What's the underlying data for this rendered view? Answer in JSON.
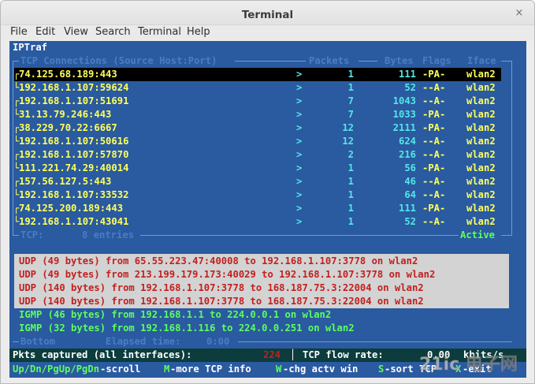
{
  "window": {
    "title": "Terminal",
    "close_glyph": "×"
  },
  "menu": [
    "File",
    "Edit",
    "View",
    "Search",
    "Terminal",
    "Help"
  ],
  "app_title": "IPTraf",
  "header": {
    "connections": "TCP Connections (Source Host:Port)",
    "packets": "Packets",
    "bytes": "Bytes",
    "flags": "Flags",
    "iface": "Iface"
  },
  "tcp_rows": [
    {
      "host": "74.125.68.189:443",
      "dir": ">",
      "packets": "1",
      "bytes": "111",
      "flags": "-PA-",
      "iface": "wlan2",
      "selected": true
    },
    {
      "host": "192.168.1.107:59624",
      "dir": ">",
      "packets": "1",
      "bytes": "52",
      "flags": "--A-",
      "iface": "wlan2"
    },
    {
      "host": "192.168.1.107:51691",
      "dir": ">",
      "packets": "7",
      "bytes": "1043",
      "flags": "--A-",
      "iface": "wlan2"
    },
    {
      "host": "31.13.79.246:443",
      "dir": ">",
      "packets": "7",
      "bytes": "1033",
      "flags": "-PA-",
      "iface": "wlan2"
    },
    {
      "host": "38.229.70.22:6667",
      "dir": ">",
      "packets": "12",
      "bytes": "2111",
      "flags": "-PA-",
      "iface": "wlan2"
    },
    {
      "host": "192.168.1.107:50616",
      "dir": ">",
      "packets": "12",
      "bytes": "624",
      "flags": "--A-",
      "iface": "wlan2"
    },
    {
      "host": "192.168.1.107:57870",
      "dir": ">",
      "packets": "2",
      "bytes": "216",
      "flags": "--A-",
      "iface": "wlan2"
    },
    {
      "host": "111.221.74.29:40014",
      "dir": ">",
      "packets": "1",
      "bytes": "56",
      "flags": "-PA-",
      "iface": "wlan2"
    },
    {
      "host": "157.56.127.5:443",
      "dir": ">",
      "packets": "1",
      "bytes": "46",
      "flags": "--A-",
      "iface": "wlan2"
    },
    {
      "host": "192.168.1.107:33532",
      "dir": ">",
      "packets": "1",
      "bytes": "64",
      "flags": "--A-",
      "iface": "wlan2"
    },
    {
      "host": "74.125.200.189:443",
      "dir": ">",
      "packets": "1",
      "bytes": "111",
      "flags": "-PA-",
      "iface": "wlan2"
    },
    {
      "host": "192.168.1.107:43041",
      "dir": ">",
      "packets": "1",
      "bytes": "52",
      "flags": "--A-",
      "iface": "wlan2"
    }
  ],
  "tcp_footer": {
    "label": "TCP:",
    "entries": "8 entries",
    "status": "Active"
  },
  "other_rows": [
    {
      "text": "UDP (49 bytes) from 65.55.223.47:40008 to 192.168.1.107:3778 on wlan2",
      "kind": "udp"
    },
    {
      "text": "UDP (49 bytes) from 213.199.179.173:40029 to 192.168.1.107:3778 on wlan2",
      "kind": "udp"
    },
    {
      "text": "UDP (140 bytes) from 192.168.1.107:3778 to 168.187.75.3:22004 on wlan2",
      "kind": "udp"
    },
    {
      "text": "UDP (140 bytes) from 192.168.1.107:3778 to 168.187.75.3:22004 on wlan2",
      "kind": "udp"
    },
    {
      "text": "IGMP (46 bytes) from 192.168.1.1 to 224.0.0.1 on wlan2",
      "kind": "igmp"
    },
    {
      "text": "IGMP (32 bytes) from 192.168.1.116 to 224.0.0.251 on wlan2",
      "kind": "igmp"
    }
  ],
  "bottom_border": {
    "label": "Bottom",
    "elapsed_label": "Elapsed time:",
    "elapsed_value": "0:00"
  },
  "status": {
    "captured_label": "Pkts captured (all interfaces):",
    "captured_value": "224",
    "flow_label": "TCP flow rate:",
    "flow_value": "0.00",
    "flow_unit": "kbits/s"
  },
  "keys": [
    {
      "key": "Up/Dn/PgUp/PgDn",
      "desc": "-scroll"
    },
    {
      "key": "M",
      "desc": "-more TCP info"
    },
    {
      "key": "W",
      "desc": "-chg actv win"
    },
    {
      "key": "S",
      "desc": "-sort TCP"
    },
    {
      "key": "X",
      "desc": "-exit"
    }
  ],
  "watermark": {
    "text": "21ic 电子网",
    "color": "#c8c8c8"
  },
  "colors": {
    "terminal_bg": "#2a5aa0",
    "host": "#ffff5a",
    "numbers": "#54e6e6",
    "udp": "#c22020",
    "igmp": "#5cff5c"
  }
}
